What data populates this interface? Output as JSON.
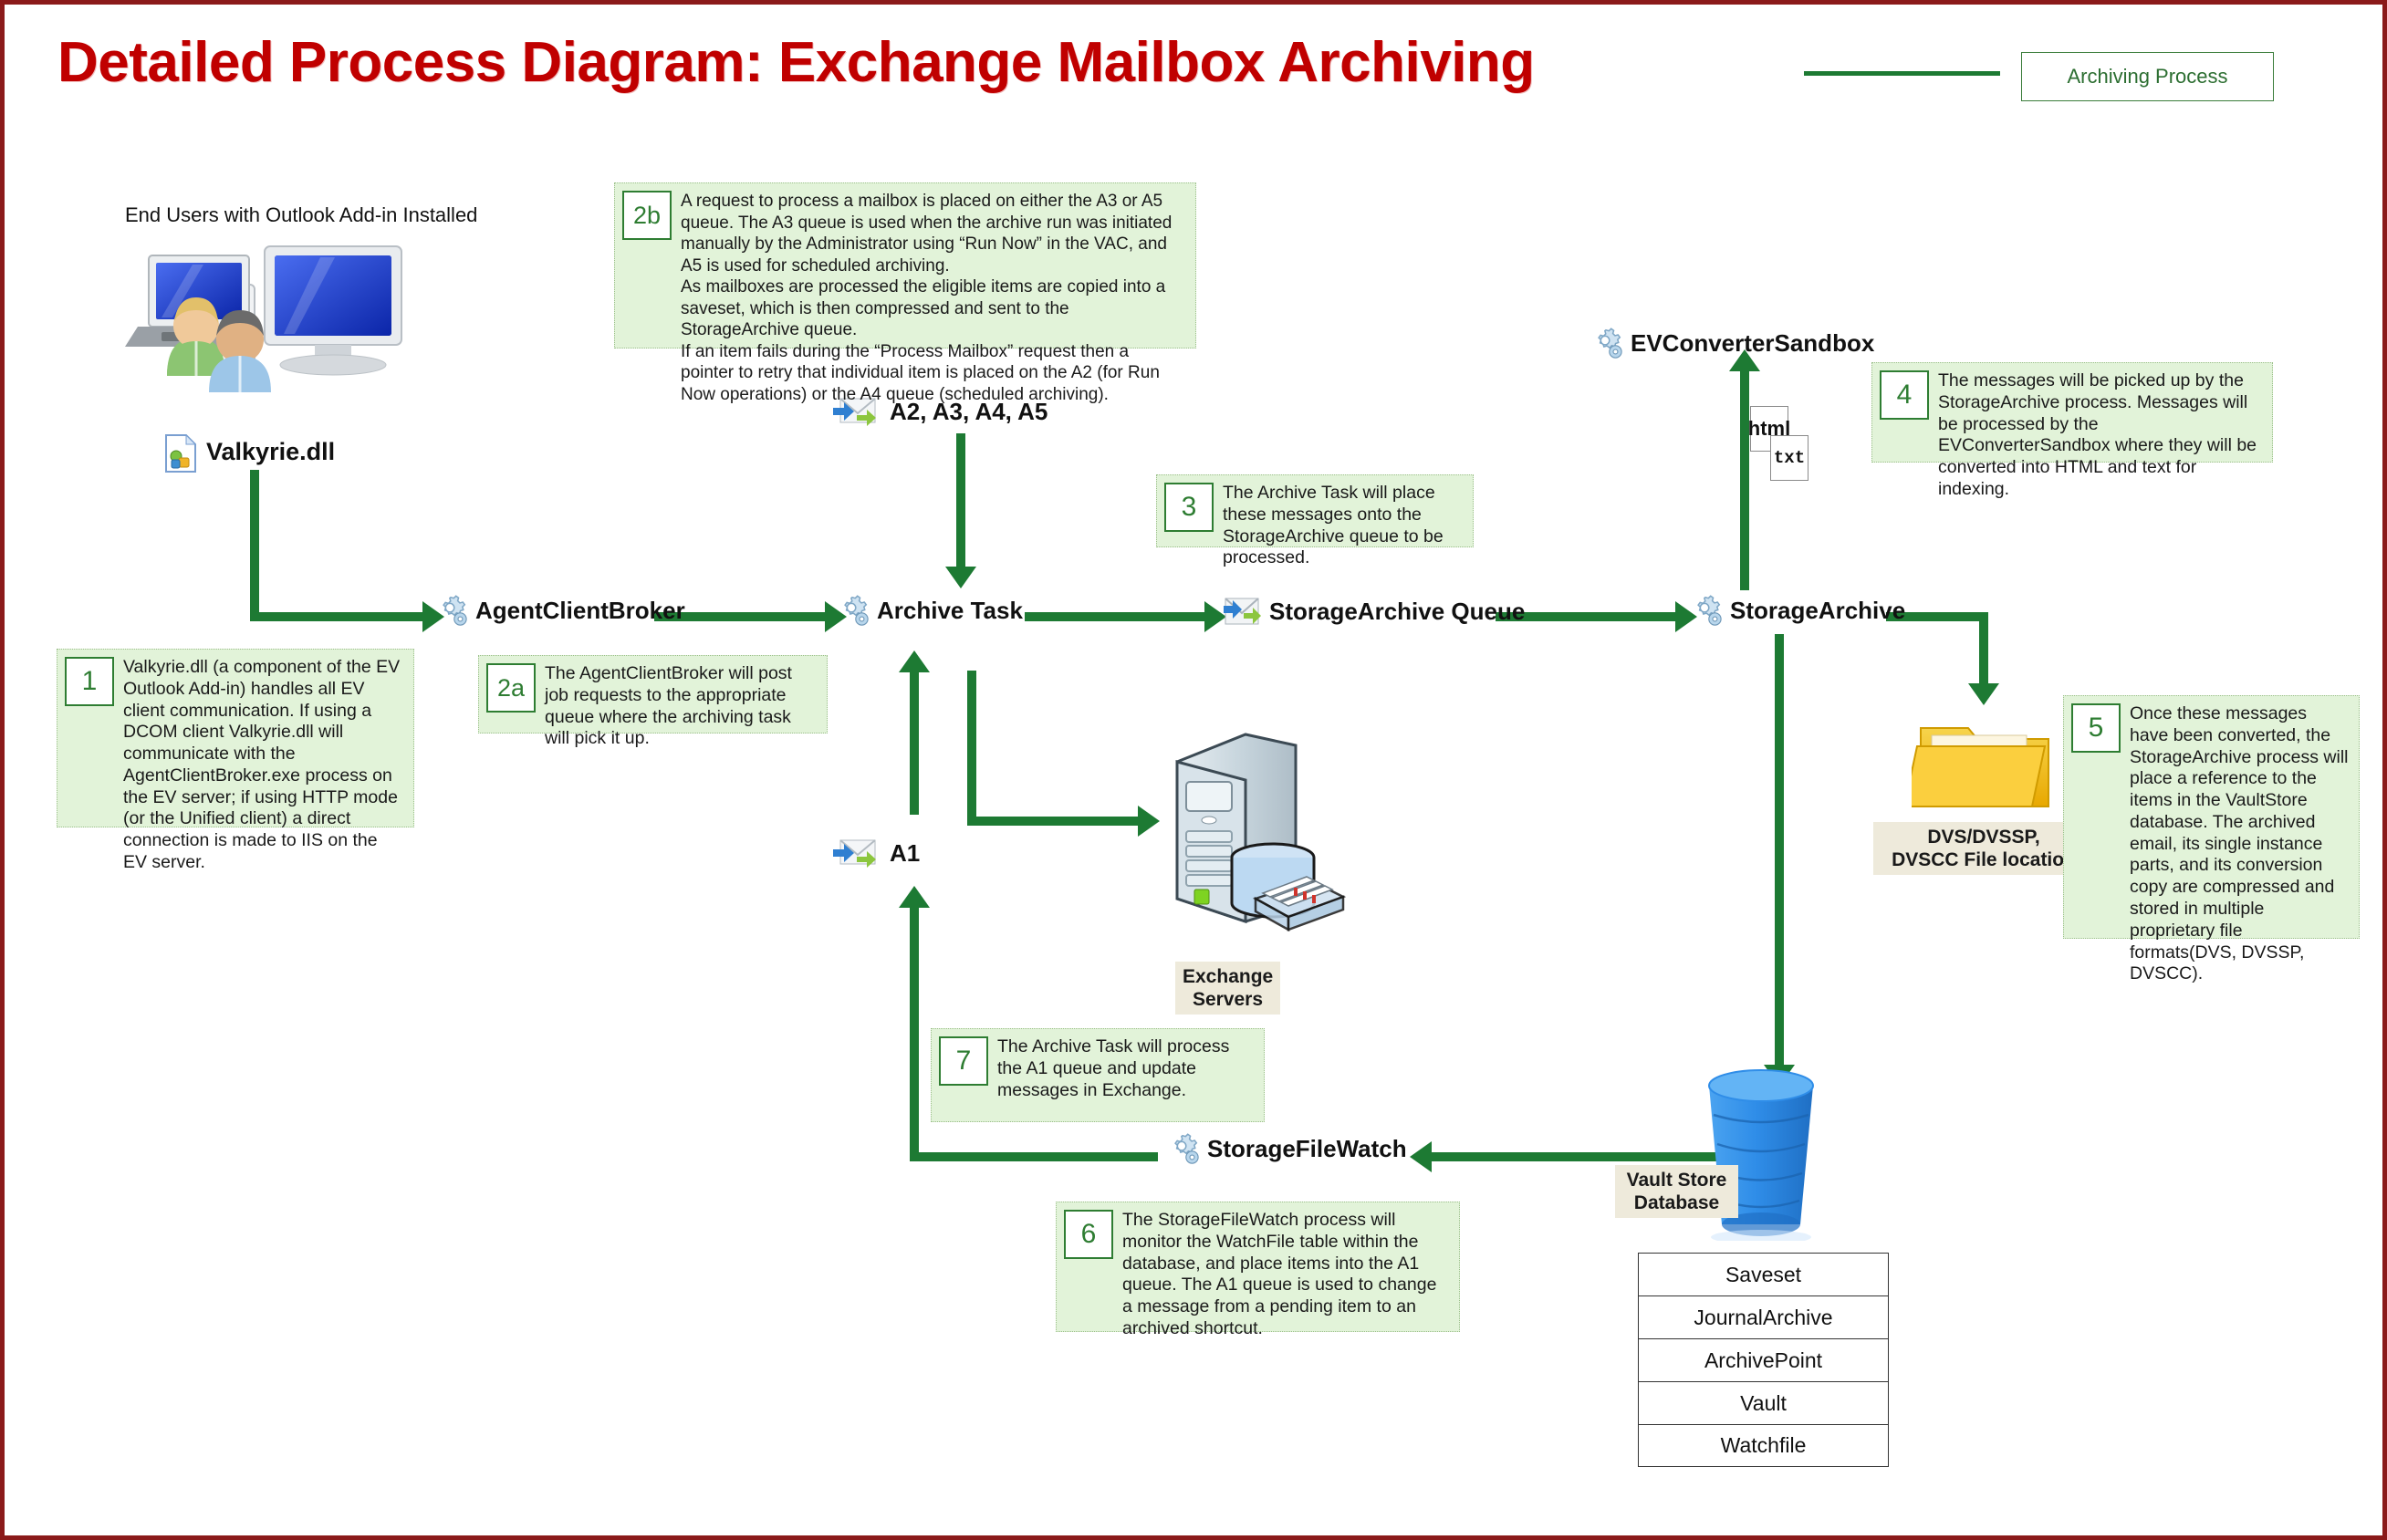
{
  "page": {
    "title": "Detailed Process Diagram: Exchange Mailbox Archiving",
    "border_color": "#8b1a1a",
    "title_color": "#c00000",
    "flow_color": "#1d7a33"
  },
  "legend": {
    "label": "Archiving Process",
    "line_color": "#1d7a33"
  },
  "actors": {
    "end_users_label": "End Users with Outlook Add-in Installed",
    "valkyrie_label": "Valkyrie.dll"
  },
  "nodes": {
    "agent_client_broker": "AgentClientBroker",
    "archive_task": "Archive Task",
    "storage_archive_queue": "StorageArchive Queue",
    "storage_archive": "StorageArchive",
    "ev_converter_sandbox": "EVConverterSandbox",
    "storage_file_watch": "StorageFileWatch"
  },
  "queues": {
    "upper": "A2, A3, A4, A5",
    "lower": "A1"
  },
  "captions": {
    "exchange_servers": "Exchange\nServers",
    "file_location": "DVS/DVSSP,\nDVSCC File location",
    "vault_store_db": "Vault Store\nDatabase"
  },
  "file_icons": {
    "html": "html",
    "txt": "txt"
  },
  "db_tables": [
    "Saveset",
    "JournalArchive",
    "ArchivePoint",
    "Vault",
    "Watchfile"
  ],
  "notes": [
    {
      "id": "1",
      "text": "Valkyrie.dll (a component of the EV Outlook Add-in) handles all EV client communication. If using a DCOM client Valkyrie.dll will communicate with the AgentClientBroker.exe process on the EV server; if using HTTP mode (or the Unified client) a direct connection is made to IIS on the EV server."
    },
    {
      "id": "2a",
      "text": "The AgentClientBroker will post job requests to the appropriate queue where the archiving task will pick it up."
    },
    {
      "id": "2b",
      "line1": "A request to process a mailbox is placed on either the A3 or A5 queue. The A3 queue is used when the archive run was initiated manually by the Administrator using “Run Now” in the VAC, and A5 is used for scheduled archiving.",
      "line2": "As mailboxes are processed the eligible items are copied into a saveset, which is then compressed and sent to the StorageArchive queue.",
      "line3": "If an item fails during the “Process Mailbox” request then a pointer to retry that individual item is placed on the A2 (for Run Now operations) or the A4 queue (scheduled archiving)."
    },
    {
      "id": "3",
      "text": "The Archive Task will place these messages onto the StorageArchive queue to be processed."
    },
    {
      "id": "4",
      "text": "The messages will be picked up by the StorageArchive process. Messages will be processed by the EVConverterSandbox where they will be converted into HTML and text for indexing."
    },
    {
      "id": "5",
      "text": "Once these messages have been converted, the StorageArchive process will place a reference to the items in the VaultStore database. The archived email, its single instance parts, and its conversion copy are compressed and stored in multiple proprietary file formats(DVS, DVSSP, DVSCC)."
    },
    {
      "id": "6",
      "text": "The StorageFileWatch process will monitor the WatchFile table within the database, and place items into the A1 queue. The A1 queue is used to change a message from a pending item to an archived shortcut."
    },
    {
      "id": "7",
      "text": "The Archive Task will process the A1 queue and update messages in Exchange."
    }
  ]
}
